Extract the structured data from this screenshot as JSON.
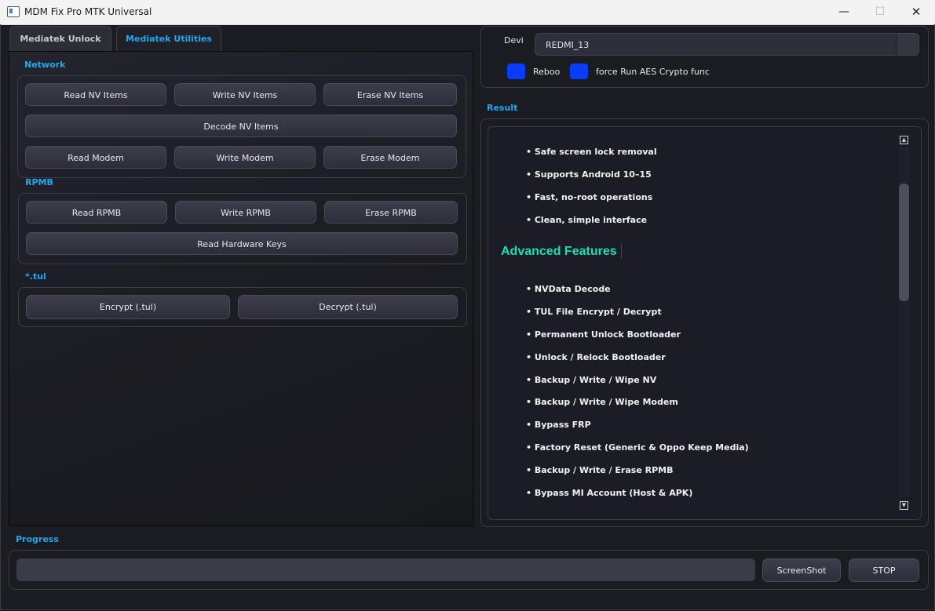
{
  "window": {
    "title": "MDM Fix Pro MTK Universal",
    "minimize": "—",
    "maximize": "☐",
    "close": "✕"
  },
  "tabs": [
    {
      "label": "Mediatek Unlock",
      "active": false
    },
    {
      "label": "Mediatek Utilities",
      "active": true
    }
  ],
  "network": {
    "title": "Network",
    "read_nv": "Read NV Items",
    "write_nv": "Write NV Items",
    "erase_nv": "Erase NV Items",
    "decode_nv": "Decode NV Items",
    "read_modem": "Read Modem",
    "write_modem": "Write Modem",
    "erase_modem": "Erase Modem"
  },
  "rpmb": {
    "title": "RPMB",
    "read": "Read RPMB",
    "write": "Write RPMB",
    "erase": "Erase RPMB",
    "read_hw_keys": "Read Hardware Keys"
  },
  "tul": {
    "title": "*.tul",
    "encrypt": "Encrypt (.tul)",
    "decrypt": "Decrypt (.tul)"
  },
  "device": {
    "label": "Devi",
    "selected": "REDMI_13",
    "reboot_label": "Reboo",
    "aes_label": "force Run AES Crypto functic",
    "checkbox_color": "#0a3cff"
  },
  "result": {
    "title": "Result",
    "basic_features": [
      "• Safe screen lock removal",
      "• Supports Android 10–15",
      "• Fast, no-root operations",
      "• Clean, simple interface"
    ],
    "advanced_heading": "Advanced Features",
    "advanced_features": [
      "• NVData Decode",
      "• TUL File Encrypt / Decrypt",
      "• Permanent Unlock Bootloader",
      "• Unlock / Relock Bootloader",
      "• Backup / Write / Wipe NV",
      "• Backup / Write / Wipe Modem",
      "• Bypass FRP",
      "• Factory Reset (Generic & Oppo Keep Media)",
      "• Backup / Write / Erase RPMB",
      "• Bypass MI Account (Host & APK)"
    ],
    "scroll_up": "▲",
    "scroll_down": "▼"
  },
  "progress": {
    "title": "Progress",
    "value": 0,
    "screenshot_label": "ScreenShot",
    "stop_label": "STOP"
  },
  "colors": {
    "accent": "#1fa8f0",
    "heading": "#18e0b5",
    "background": "#1b1c22"
  }
}
